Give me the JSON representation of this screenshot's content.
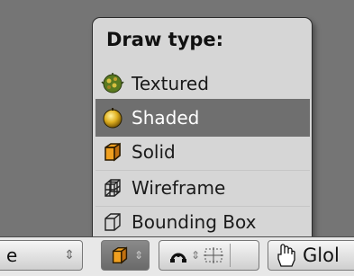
{
  "menu": {
    "title": "Draw type:",
    "items": [
      {
        "label": "Textured",
        "icon": "textured-sphere-icon",
        "selected": false
      },
      {
        "label": "Shaded",
        "icon": "shaded-sphere-icon",
        "selected": true
      },
      {
        "label": "Solid",
        "icon": "solid-cube-icon",
        "selected": false
      },
      {
        "label": "Wireframe",
        "icon": "wireframe-cube-icon",
        "selected": false
      },
      {
        "label": "Bounding Box",
        "icon": "bounding-box-icon",
        "selected": false
      }
    ]
  },
  "header": {
    "mode_value": "e",
    "orientation_value": "Glol"
  },
  "colors": {
    "viewport": "#757575",
    "menu_bg": "#d6d6d6",
    "selected_bg": "#6f6f6f",
    "cube_orange": "#f0a020",
    "sphere_yellow": "#e8c020"
  }
}
